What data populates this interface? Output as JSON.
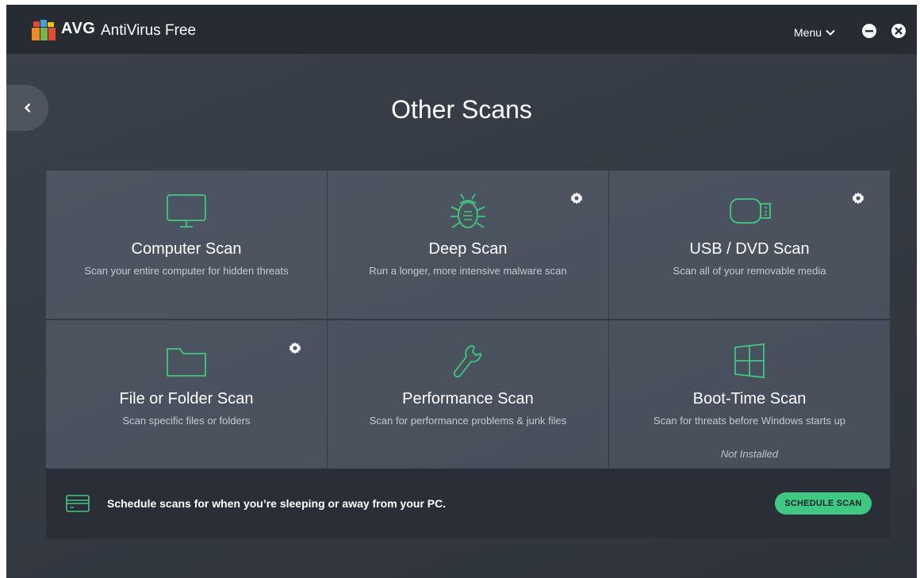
{
  "app": {
    "logo_text": "AVG",
    "name": "AntiVirus Free",
    "menu_label": "Menu"
  },
  "colors": {
    "accent": "#3ec982",
    "background": "#353b44",
    "titlebar": "#272b32"
  },
  "icons": {
    "back": "chevron-left-icon",
    "minimize": "minus-circle-icon",
    "close": "x-circle-icon",
    "menu": "chevron-down-icon",
    "settings": "gear-icon"
  },
  "page": {
    "title": "Other Scans"
  },
  "scans": [
    {
      "title": "Computer Scan",
      "description": "Scan your entire computer for hidden threats",
      "icon": "monitor-icon",
      "has_settings": false,
      "status": ""
    },
    {
      "title": "Deep Scan",
      "description": "Run a longer, more intensive malware scan",
      "icon": "bug-icon",
      "has_settings": true,
      "status": ""
    },
    {
      "title": "USB / DVD Scan",
      "description": "Scan all of your removable media",
      "icon": "usb-drive-icon",
      "has_settings": true,
      "status": ""
    },
    {
      "title": "File or Folder Scan",
      "description": "Scan specific files or folders",
      "icon": "folder-icon",
      "has_settings": true,
      "status": ""
    },
    {
      "title": "Performance Scan",
      "description": "Scan for performance problems & junk files",
      "icon": "wrench-icon",
      "has_settings": false,
      "status": ""
    },
    {
      "title": "Boot-Time Scan",
      "description": "Scan for threats before Windows starts up",
      "icon": "windows-icon",
      "has_settings": false,
      "status": "Not Installed"
    }
  ],
  "schedule": {
    "icon": "calendar-card-icon",
    "text": "Schedule scans for when you’re sleeping or away from your PC.",
    "button_label": "SCHEDULE SCAN"
  }
}
